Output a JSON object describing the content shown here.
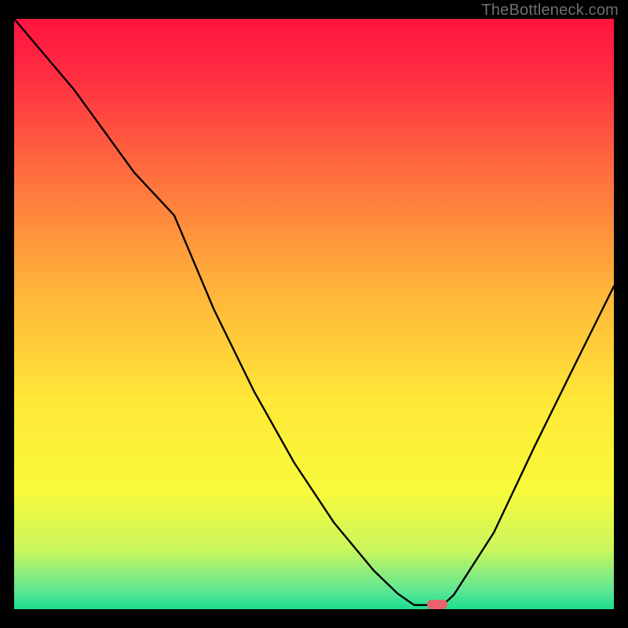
{
  "watermark": "TheBottleneck.com",
  "chart_data": {
    "type": "line",
    "title": "",
    "xlabel": "",
    "ylabel": "",
    "xlim": [
      0,
      100
    ],
    "ylim": [
      0,
      100
    ],
    "series": [
      {
        "name": "curve",
        "x": [
          0,
          10,
          20,
          26.7,
          33.3,
          40,
          46.7,
          53.3,
          60,
          64,
          66.7,
          70,
          72,
          73.3,
          80,
          86.7,
          93.3,
          100
        ],
        "y": [
          100,
          88,
          74,
          66.7,
          50.8,
          36.9,
          24.8,
          14.7,
          6.5,
          2.6,
          0.7,
          0.7,
          1.2,
          2.4,
          13,
          27.4,
          41.0,
          54.7
        ]
      }
    ],
    "marker": {
      "x": 70.5,
      "y": 0.8
    },
    "gradient_stops": [
      {
        "offset": 0.0,
        "color": "#ff133f"
      },
      {
        "offset": 0.1,
        "color": "#ff2e42"
      },
      {
        "offset": 0.25,
        "color": "#ff6a3e"
      },
      {
        "offset": 0.45,
        "color": "#ffb13a"
      },
      {
        "offset": 0.65,
        "color": "#ffe837"
      },
      {
        "offset": 0.8,
        "color": "#f8fa3b"
      },
      {
        "offset": 0.9,
        "color": "#c9f65d"
      },
      {
        "offset": 0.97,
        "color": "#5be695"
      },
      {
        "offset": 1.0,
        "color": "#1adf8d"
      }
    ]
  }
}
